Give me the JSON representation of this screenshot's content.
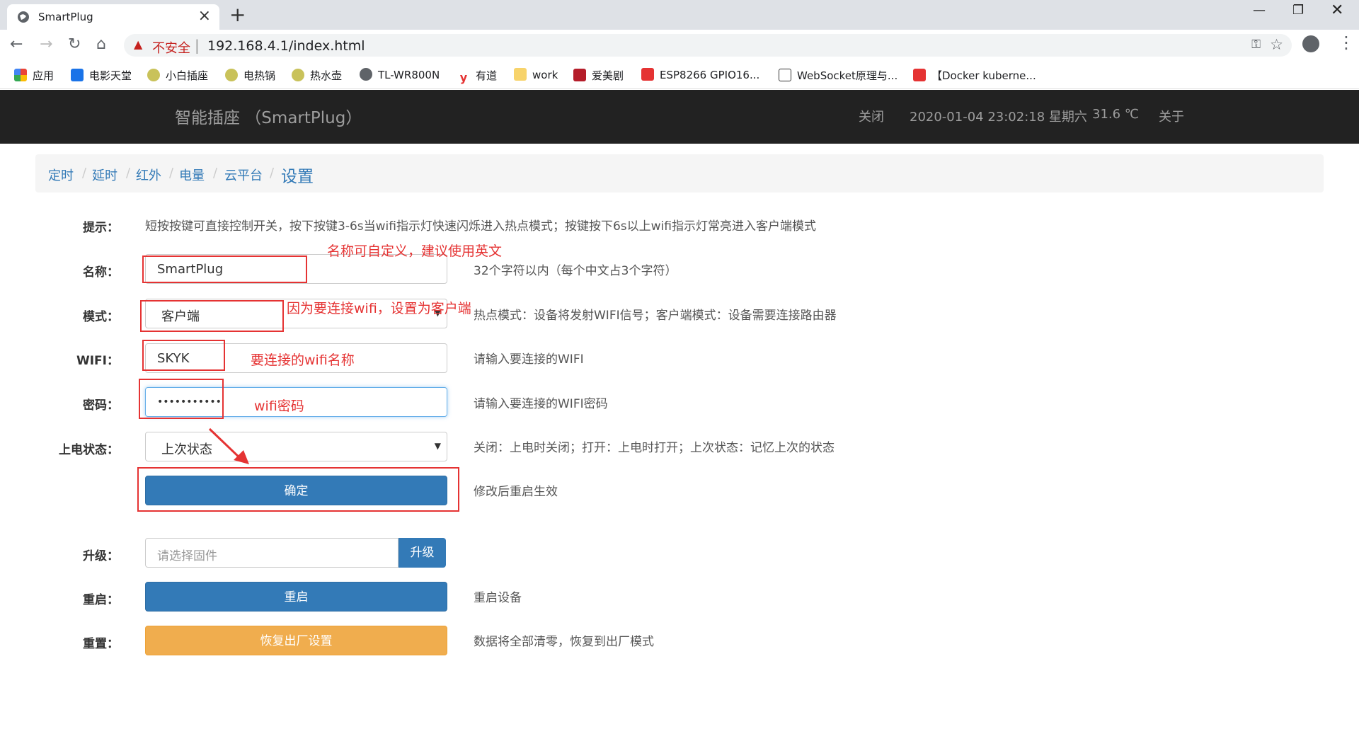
{
  "browser": {
    "tab_title": "SmartPlug",
    "insecure_label": "不安全",
    "url": "192.168.4.1/index.html",
    "bookmarks": [
      "应用",
      "电影天堂",
      "小白插座",
      "电热锅",
      "热水壶",
      "TL-WR800N",
      "有道",
      "work",
      "爱美剧",
      "ESP8266 GPIO16...",
      "WebSocket原理与...",
      "【Docker kuberne..."
    ]
  },
  "navbar": {
    "brand": "智能插座 （SmartPlug）",
    "power": "关闭",
    "datetime": "2020-01-04 23:02:18 星期六",
    "temperature": "31.6 ℃",
    "about": "关于"
  },
  "breadcrumb": [
    "定时",
    "延时",
    "红外",
    "电量",
    "云平台",
    "设置"
  ],
  "form": {
    "tip_label": "提示：",
    "tip_text": "短按按键可直接控制开关，按下按键3-6s当wifi指示灯快速闪烁进入热点模式；按键按下6s以上wifi指示灯常亮进入客户端模式",
    "name_label": "名称：",
    "name_value": "SmartPlug",
    "name_help": "32个字符以内（每个中文占3个字符）",
    "mode_label": "模式：",
    "mode_value": "客户端",
    "mode_help": "热点模式：设备将发射WIFI信号；客户端模式：设备需要连接路由器",
    "wifi_label": "WIFI：",
    "wifi_value": "SKYK",
    "wifi_help": "请输入要连接的WIFI",
    "password_label": "密码：",
    "password_value": "•••••••••••",
    "password_help": "请输入要连接的WIFI密码",
    "power_state_label": "上电状态：",
    "power_state_value": "上次状态",
    "power_state_help": "关闭：上电时关闭；打开：上电时打开；上次状态：记忆上次的状态",
    "confirm_button": "确定",
    "confirm_help": "修改后重启生效",
    "upgrade_label": "升级：",
    "upgrade_placeholder": "请选择固件",
    "upgrade_button": "升级",
    "restart_label": "重启：",
    "restart_button": "重启",
    "restart_help": "重启设备",
    "reset_label": "重置：",
    "reset_button": "恢复出厂设置",
    "reset_help": "数据将全部清零，恢复到出厂模式"
  },
  "annotations": {
    "name_note": "名称可自定义，建议使用英文",
    "mode_note": "因为要连接wifi，设置为客户端",
    "wifi_note": "要连接的wifi名称",
    "password_note": "wifi密码"
  },
  "colors": {
    "navbar_bg": "#222222",
    "primary": "#337ab7",
    "warning": "#f0ad4e",
    "annotation_red": "#e53333"
  }
}
